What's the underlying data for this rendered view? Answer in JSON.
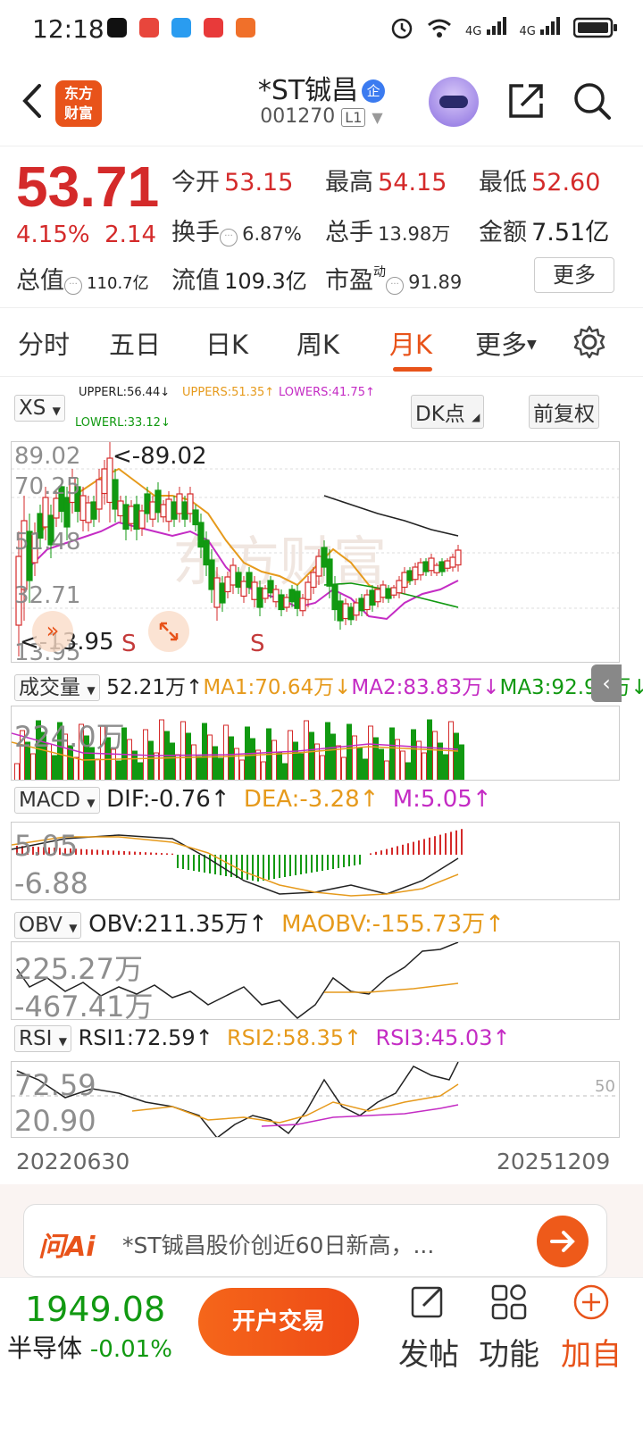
{
  "status": {
    "time": "12:18",
    "net1": "4G",
    "net2": "4G"
  },
  "header": {
    "title": "*ST铖昌",
    "badge": "企",
    "code": "001270",
    "level": "L1",
    "logo_line1": "东方",
    "logo_line2": "财富"
  },
  "quote": {
    "price": "53.71",
    "change_pct": "4.15%",
    "change_amt": "2.14",
    "open_label": "今开",
    "open": "53.15",
    "high_label": "最高",
    "high": "54.15",
    "low_label": "最低",
    "low": "52.60",
    "turnover_label": "换手",
    "turnover": "6.87%",
    "volume_label": "总手",
    "volume": "13.98万",
    "amount_label": "金额",
    "amount": "7.51亿",
    "mcap_label": "总值",
    "mcap": "110.7亿",
    "float_label": "流值",
    "float": "109.3亿",
    "pe_label": "市盈",
    "pe_sup": "动",
    "pe": "91.89",
    "more": "更多"
  },
  "tabs": [
    "分时",
    "五日",
    "日K",
    "周K",
    "月K",
    "更多"
  ],
  "active_tab": "月K",
  "kline": {
    "selector": "XS",
    "upperl": "UPPERL:56.44↓",
    "uppers": "UPPERS:51.35↑",
    "lowers": "LOWERS:41.75↑",
    "lowerl": "LOWERL:33.12↓",
    "dk_btn": "DK点",
    "fq_btn": "前复权",
    "y_labels": [
      "89.02",
      "70.25",
      "51.48",
      "32.71",
      "13.95"
    ],
    "high_mark": "<-89.02",
    "low_mark": "<-13.95",
    "signal": "S"
  },
  "volume": {
    "selector": "成交量",
    "value": "52.21万↑",
    "ma1": "MA1:70.64万↓",
    "ma2": "MA2:83.83万↓",
    "ma3": "MA3:92.98万↓",
    "y_label": "224.0万"
  },
  "macd": {
    "selector": "MACD",
    "dif": "DIF:-0.76↑",
    "dea": "DEA:-3.28↑",
    "m": "M:5.05↑",
    "y_labels": [
      "5.05",
      "-6.88"
    ]
  },
  "obv": {
    "selector": "OBV",
    "obv": "OBV:211.35万↑",
    "maobv": "MAOBV:-155.73万↑",
    "y_labels": [
      "225.27万",
      "-467.41万"
    ]
  },
  "rsi": {
    "selector": "RSI",
    "rsi1": "RSI1:72.59↑",
    "rsi2": "RSI2:58.35↑",
    "rsi3": "RSI3:45.03↑",
    "y_labels": [
      "72.59",
      "20.90"
    ],
    "ref": "50"
  },
  "dates": {
    "start": "20220630",
    "end": "20251209"
  },
  "ai": {
    "logo": "问Ai",
    "text": "*ST铖昌股价创近60日新高，..."
  },
  "bottom": {
    "index_value": "1949.08",
    "index_name": "半导体",
    "index_change": "-0.01%",
    "open_account": "开户交易",
    "post": "发帖",
    "functions": "功能",
    "add": "加自"
  },
  "colors": {
    "up": "#d42a2a",
    "down": "#119911",
    "accent": "#e8531a",
    "ma_orange": "#e69a1c",
    "ma_purple": "#c42cc4"
  }
}
